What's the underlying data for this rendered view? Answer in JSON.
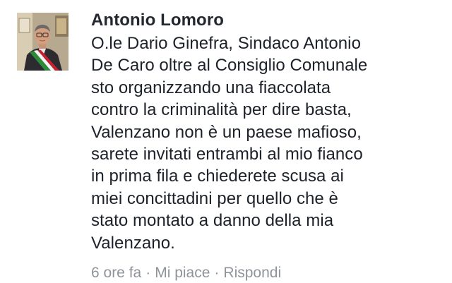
{
  "comment": {
    "author": "Antonio Lomoro",
    "text_lines": [
      "O.le Dario Ginefra,  Sindaco Antonio",
      "De Caro oltre al Consiglio Comunale",
      "sto organizzando una fiaccolata",
      "contro la criminalità per dire basta,",
      "Valenzano non è un paese mafioso,",
      "sarete invitati entrambi al mio fianco",
      "in prima fila e chiederete scusa ai",
      "miei concittadini per quello che è",
      "stato montato a danno della mia",
      "Valenzano."
    ],
    "timestamp": "6 ore fa",
    "separator": "·",
    "like_label": "Mi piace",
    "reply_label": "Rispondi"
  },
  "colors": {
    "author": "#23272f",
    "text": "#1d2129",
    "meta": "#8f949b",
    "sash_green": "#2e8b3a",
    "sash_white": "#f4f4f4",
    "sash_red": "#c8202e"
  }
}
